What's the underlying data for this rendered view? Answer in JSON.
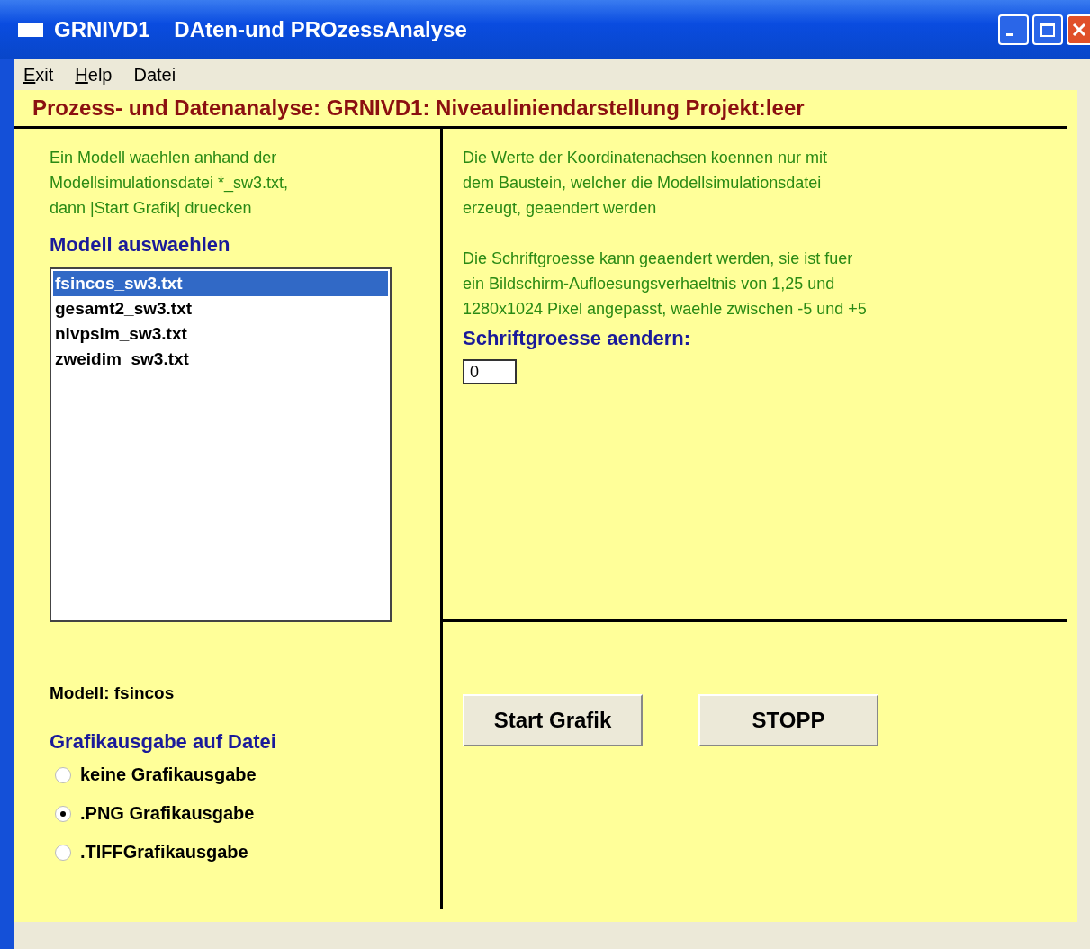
{
  "window": {
    "title": "GRNIVD1    DAten-und PROzessAnalyse"
  },
  "menu": [
    {
      "label": "Exit",
      "mnemonic": true
    },
    {
      "label": "Help",
      "mnemonic": true
    },
    {
      "label": "Datei",
      "mnemonic": false
    }
  ],
  "header": "Prozess- und Datenanalyse: GRNIVD1: Niveauliniendarstellung  Projekt:leer",
  "left": {
    "instructions": [
      "Ein Modell waehlen anhand der",
      "Modellsimulationsdatei *_sw3.txt,",
      "dann  |Start Grafik|  druecken"
    ],
    "list_heading": "Modell auswaehlen",
    "models": [
      {
        "label": "fsincos_sw3.txt",
        "selected": true
      },
      {
        "label": "gesamt2_sw3.txt",
        "selected": false
      },
      {
        "label": "nivpsim_sw3.txt",
        "selected": false
      },
      {
        "label": "zweidim_sw3.txt",
        "selected": false
      }
    ],
    "current_model": "Modell: fsincos",
    "output_heading": "Grafikausgabe auf Datei",
    "output_options": [
      {
        "label": "keine Grafikausgabe",
        "selected": false
      },
      {
        "label": ".PNG Grafikausgabe",
        "selected": true
      },
      {
        "label": ".TIFFGrafikausgabe",
        "selected": false
      }
    ]
  },
  "right": {
    "axis_note": [
      "Die Werte der Koordinatenachsen koennen nur mit",
      "dem Baustein, welcher die Modellsimulationsdatei",
      "erzeugt, geaendert werden"
    ],
    "font_note": [
      "Die Schriftgroesse kann geaendert werden, sie ist fuer",
      "ein Bildschirm-Aufloesungsverhaeltnis von 1,25 und",
      "1280x1024 Pixel angepasst, waehle zwischen -5 und +5"
    ],
    "font_size_label": "Schriftgroesse aendern:",
    "font_size_value": "0",
    "buttons": [
      "Start Grafik",
      "STOPP"
    ]
  }
}
